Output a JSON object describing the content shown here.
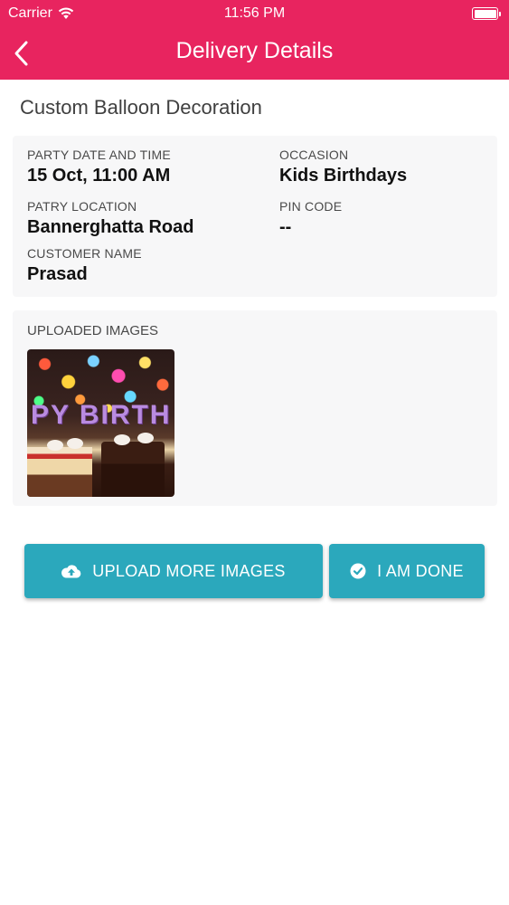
{
  "status_bar": {
    "carrier": "Carrier",
    "time": "11:56 PM",
    "wifi_icon": "wifi-icon",
    "battery_icon": "battery-icon"
  },
  "nav": {
    "title": "Delivery Details",
    "back_icon": "chevron-left-icon"
  },
  "service_title": "Custom Balloon Decoration",
  "details": {
    "party_date_label": "PARTY DATE AND TIME",
    "party_date_value": "15 Oct, 11:00 AM",
    "occasion_label": "OCCASION",
    "occasion_value": "Kids Birthdays",
    "location_label": "PATRY LOCATION",
    "location_value": "Bannerghatta Road",
    "pin_label": "PIN CODE",
    "pin_value": "--",
    "customer_label": "CUSTOMER NAME",
    "customer_value": "Prasad"
  },
  "images": {
    "label": "UPLOADED IMAGES",
    "thumbnail_caption": "PY BIRTH"
  },
  "actions": {
    "upload_label": "UPLOAD MORE IMAGES",
    "upload_icon": "cloud-upload-icon",
    "done_label": "I AM DONE",
    "done_icon": "check-circle-icon"
  },
  "colors": {
    "header": "#e8245f",
    "button": "#2ba8bc",
    "card": "#f7f7f8"
  }
}
